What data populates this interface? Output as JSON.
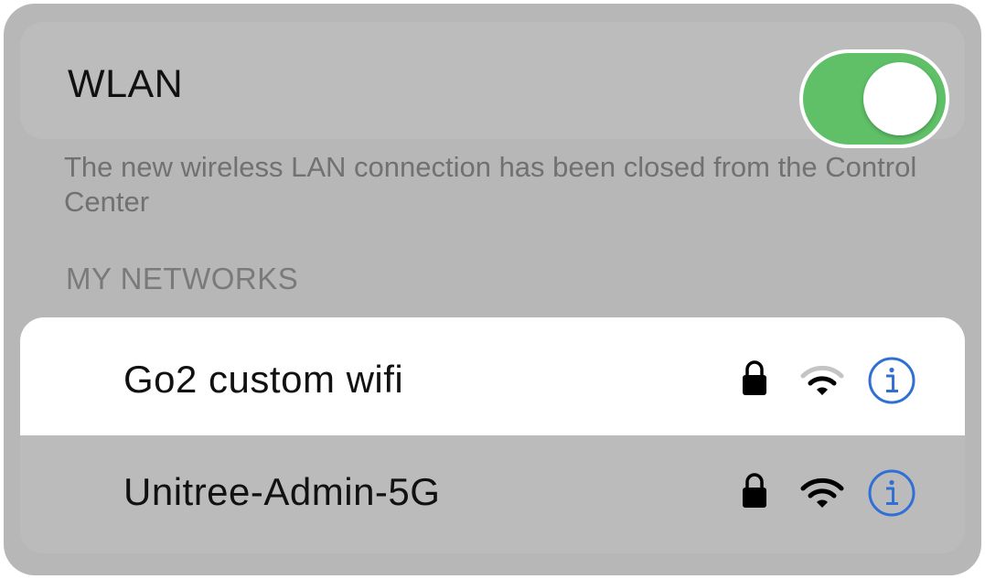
{
  "wlan": {
    "label": "WLAN",
    "enabled": true,
    "toggle_color": "#5fc067"
  },
  "note": "The new wireless LAN connection has been closed from the Control Center",
  "networks_section": {
    "header": "MY NETWORKS",
    "items": [
      {
        "name": "Go2 custom wifi",
        "secured": true,
        "signal_bars_active": 2,
        "highlighted": true,
        "icons": [
          "lock-icon",
          "wifi-icon",
          "info-icon"
        ]
      },
      {
        "name": "Unitree-Admin-5G",
        "secured": true,
        "signal_bars_active": 3,
        "highlighted": false,
        "icons": [
          "lock-icon",
          "wifi-icon",
          "info-icon"
        ]
      }
    ]
  },
  "colors": {
    "accent": "#2f6fd6",
    "background": "#b7b7b7",
    "secondary_text": "#717171"
  }
}
